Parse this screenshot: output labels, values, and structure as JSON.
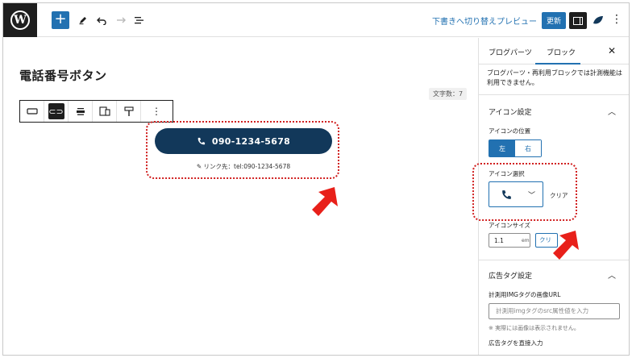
{
  "toolbar": {
    "switch_draft": "下書きへ切り替え",
    "preview": "プレビュー",
    "update": "更新"
  },
  "editor": {
    "post_title": "電話番号ボタン",
    "char_count": "文字数：7",
    "tel_button_label": "090-1234-5678",
    "link_note": "リンク先：tel:090-1234-5678"
  },
  "sidebar": {
    "tabs": [
      "ブログパーツ",
      "ブロック"
    ],
    "notice": "ブログパーツ・再利用ブロックでは計測機能は利用できません。",
    "icon_settings": {
      "title": "アイコン設定",
      "position_label": "アイコンの位置",
      "position_options": [
        "左",
        "右"
      ],
      "selected_position": "左",
      "select_label": "アイコン選択",
      "clear_label": "クリア",
      "size_label": "アイコンサイズ",
      "size_value": "1.1",
      "size_unit": "em",
      "size_clear": "クリア"
    },
    "ad_tag": {
      "title": "広告タグ設定",
      "img_url_label": "計測用IMGタグの画像URL",
      "img_url_placeholder": "計測用imgタグのsrc属性値を入力",
      "img_url_help": "※ 実際には画像は表示されません。",
      "direct_input_label": "広告タグを直接入力"
    }
  },
  "colors": {
    "accent": "#2271b1",
    "button_bg": "#12385a",
    "highlight": "#d12020",
    "arrow": "#e8201a"
  }
}
